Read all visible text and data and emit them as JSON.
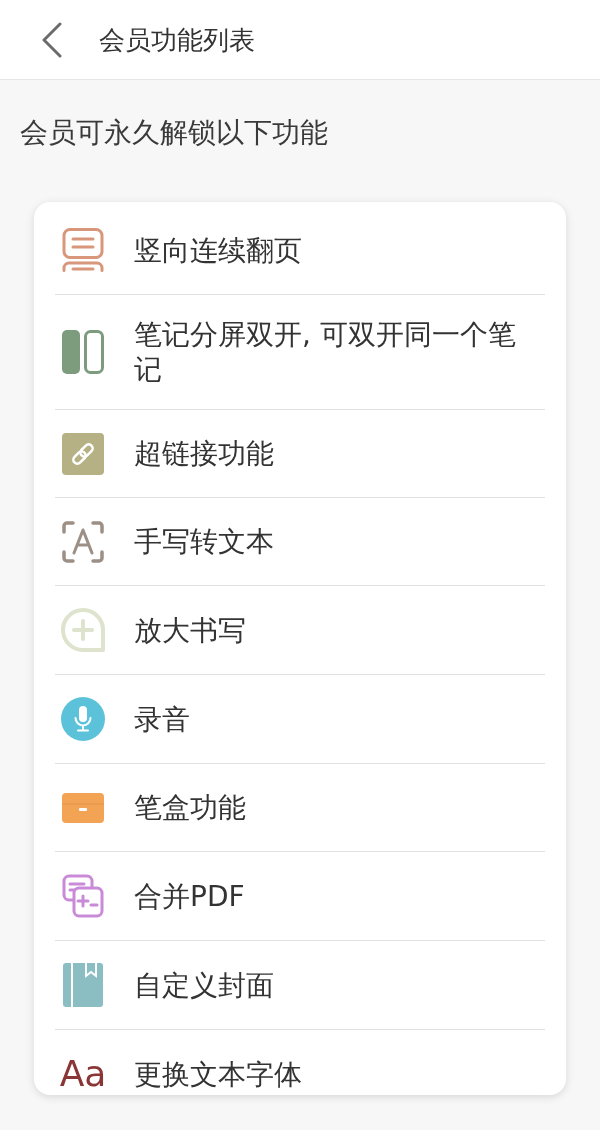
{
  "header": {
    "title": "会员功能列表"
  },
  "subtitle": "会员可永久解锁以下功能",
  "features": [
    {
      "kind": "vertical_pages",
      "label": "竖向连续翻页"
    },
    {
      "kind": "split_view",
      "label": "笔记分屏双开, 可双开同一个笔记"
    },
    {
      "kind": "link",
      "label": "超链接功能"
    },
    {
      "kind": "handwriting_to_text",
      "label": "手写转文本"
    },
    {
      "kind": "magnify",
      "label": "放大书写"
    },
    {
      "kind": "record",
      "label": "录音"
    },
    {
      "kind": "pencil_case",
      "label": "笔盒功能"
    },
    {
      "kind": "merge_pdf",
      "label": "合并PDF"
    },
    {
      "kind": "cover",
      "label": "自定义封面"
    },
    {
      "kind": "font",
      "icon_text": "Aa",
      "label": "更换文本字体"
    }
  ]
}
